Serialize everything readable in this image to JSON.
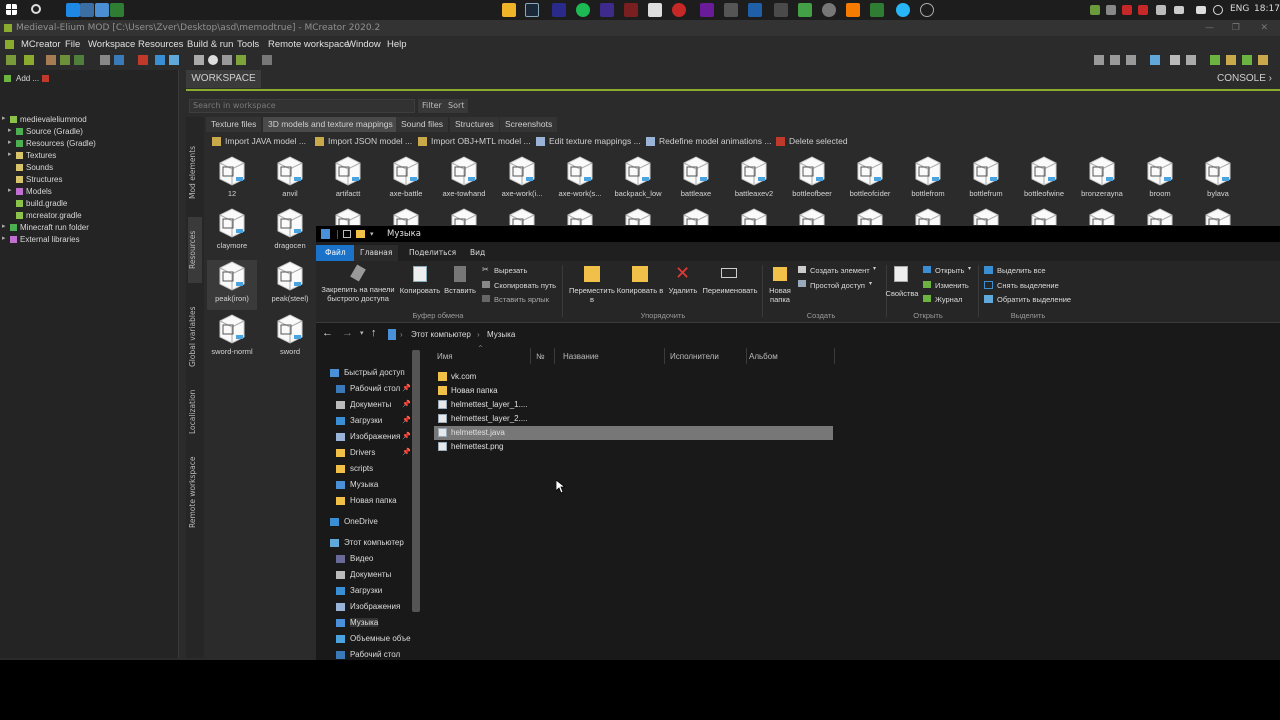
{
  "mcreator": {
    "title": "Medieval-Elium MOD [C:\\Users\\Zver\\Desktop\\asd\\memodtrue] - MCreator 2020.2",
    "menu": [
      "MCreator",
      "File",
      "Workspace",
      "Resources",
      "Build & run",
      "Tools",
      "Remote workspace",
      "Window",
      "Help"
    ],
    "add_label": "Add ...",
    "tree": [
      {
        "label": "medievaleliummod",
        "color": "#8bc34a"
      },
      {
        "label": "Source (Gradle)",
        "color": "#4caf50"
      },
      {
        "label": "Resources (Gradle)",
        "color": "#4caf50"
      },
      {
        "label": "Textures",
        "color": "#d6c36a"
      },
      {
        "label": "Sounds",
        "color": "#d6c36a"
      },
      {
        "label": "Structures",
        "color": "#d6c36a"
      },
      {
        "label": "Models",
        "color": "#c26fd1"
      },
      {
        "label": "build.gradle",
        "color": "#8bc34a"
      },
      {
        "label": "mcreator.gradle",
        "color": "#8bc34a"
      },
      {
        "label": "Minecraft run folder",
        "color": "#4caf50"
      },
      {
        "label": "External libraries",
        "color": "#c26fd1"
      }
    ],
    "workspace_tab": "WORKSPACE",
    "console_tab": "CONSOLE",
    "search_placeholder": "Search in workspace",
    "filter_label": "Filter",
    "sort_label": "Sort",
    "side_tabs": [
      "Mod elements",
      "Resources",
      "Global variables",
      "Localization",
      "Remote workspace"
    ],
    "sub_tabs": [
      "Texture files",
      "3D models and texture mappings",
      "Sound files",
      "Structures",
      "Screenshots"
    ],
    "actions": [
      "Import JAVA model ...",
      "Import JSON model ...",
      "Import OBJ+MTL model ...",
      "Edit texture mappings ...",
      "Redefine model animations ...",
      "Delete selected"
    ],
    "models_row1": [
      "12",
      "anvil",
      "artifactt",
      "axe-battle",
      "axe-towhand",
      "axe-work(i...",
      "axe-work(s...",
      "backpack_low",
      "battleaxe",
      "battleaxev2",
      "bottleofbeer",
      "bottleofcider",
      "bottlefrom",
      "bottlefrum",
      "bottleofwine",
      "bronzerayna",
      "broom",
      "bylava"
    ],
    "models_col": [
      "claymore",
      "dragocen",
      "peak(iron)",
      "peak(steel)",
      "sword-norml",
      "sword"
    ]
  },
  "explorer": {
    "title": "Музыка",
    "tabs": [
      "Файл",
      "Главная",
      "Поделиться",
      "Вид"
    ],
    "ribbon": {
      "pin": "Закрепить на панели быстрого доступа",
      "copy": "Копировать",
      "paste": "Вставить",
      "cut": "Вырезать",
      "copy_path": "Скопировать путь",
      "paste_shortcut": "Вставить ярлык",
      "clipboard_group": "Буфер обмена",
      "move": "Переместить в",
      "copy_to": "Копировать в",
      "delete": "Удалить",
      "rename": "Переименовать",
      "organize_group": "Упорядочить",
      "new_folder": "Новая папка",
      "new_item": "Создать элемент",
      "easy_access": "Простой доступ",
      "create_group": "Создать",
      "properties": "Свойства",
      "open": "Открыть",
      "edit": "Изменить",
      "history": "Журнал",
      "open_group": "Открыть",
      "select_all": "Выделить все",
      "select_none": "Снять выделение",
      "invert": "Обратить выделение",
      "select_group": "Выделить"
    },
    "breadcrumb": [
      "Этот компьютер",
      "Музыка"
    ],
    "columns": [
      "Имя",
      "№",
      "Название",
      "Исполнители",
      "Альбом"
    ],
    "nav": [
      {
        "label": "Быстрый доступ",
        "pin": false
      },
      {
        "label": "Рабочий стол",
        "pin": true
      },
      {
        "label": "Документы",
        "pin": true
      },
      {
        "label": "Загрузки",
        "pin": true
      },
      {
        "label": "Изображения",
        "pin": true
      },
      {
        "label": "Drivers",
        "pin": true
      },
      {
        "label": "scripts",
        "pin": false
      },
      {
        "label": "Музыка",
        "pin": false
      },
      {
        "label": "Новая папка",
        "pin": false
      },
      {
        "label": "OneDrive",
        "pin": false
      },
      {
        "label": "Этот компьютер",
        "pin": false
      },
      {
        "label": "Видео",
        "pin": false
      },
      {
        "label": "Документы",
        "pin": false
      },
      {
        "label": "Загрузки",
        "pin": false
      },
      {
        "label": "Изображения",
        "pin": false
      },
      {
        "label": "Музыка",
        "pin": false
      },
      {
        "label": "Объемные объе",
        "pin": false
      },
      {
        "label": "Рабочий стол",
        "pin": false
      }
    ],
    "files": [
      {
        "name": "vk.com",
        "type": "folder"
      },
      {
        "name": "Новая папка",
        "type": "folder"
      },
      {
        "name": "helmettest_layer_1....",
        "type": "file"
      },
      {
        "name": "helmettest_layer_2....",
        "type": "file"
      },
      {
        "name": "helmettest.java",
        "type": "file",
        "selected": true
      },
      {
        "name": "helmettest.png",
        "type": "file"
      }
    ]
  },
  "taskbar": {
    "lang": "ENG",
    "time": "18:17"
  }
}
